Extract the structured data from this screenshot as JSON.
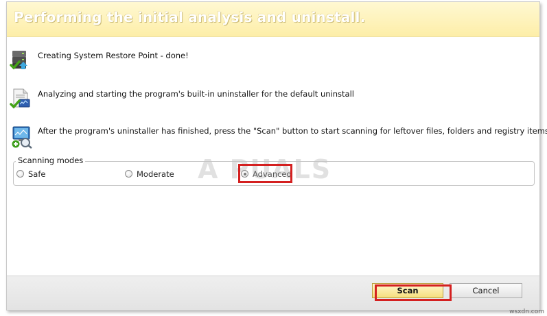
{
  "header": {
    "title": "Performing the initial analysis and uninstall."
  },
  "steps": [
    {
      "icon": "restore-point-check-icon",
      "text": "Creating System Restore Point - done!"
    },
    {
      "icon": "document-check-icon",
      "text": "Analyzing and starting the program's built-in uninstaller for the default uninstall"
    },
    {
      "icon": "monitor-scan-icon",
      "text": "After the program's uninstaller has finished, press the \"Scan\" button to start scanning for leftover files, folders and registry items."
    }
  ],
  "scanning_modes": {
    "label": "Scanning modes",
    "options": [
      {
        "label": "Safe",
        "checked": false
      },
      {
        "label": "Moderate",
        "checked": false
      },
      {
        "label": "Advanced",
        "checked": true
      }
    ]
  },
  "buttons": {
    "scan": "Scan",
    "cancel": "Cancel"
  },
  "watermark": "A PUALS",
  "corner_mark": "wsxdn.com",
  "colors": {
    "highlight": "#d42020",
    "header_bg": "#fdeea8",
    "scan_button_bg": "#f6df7e"
  }
}
